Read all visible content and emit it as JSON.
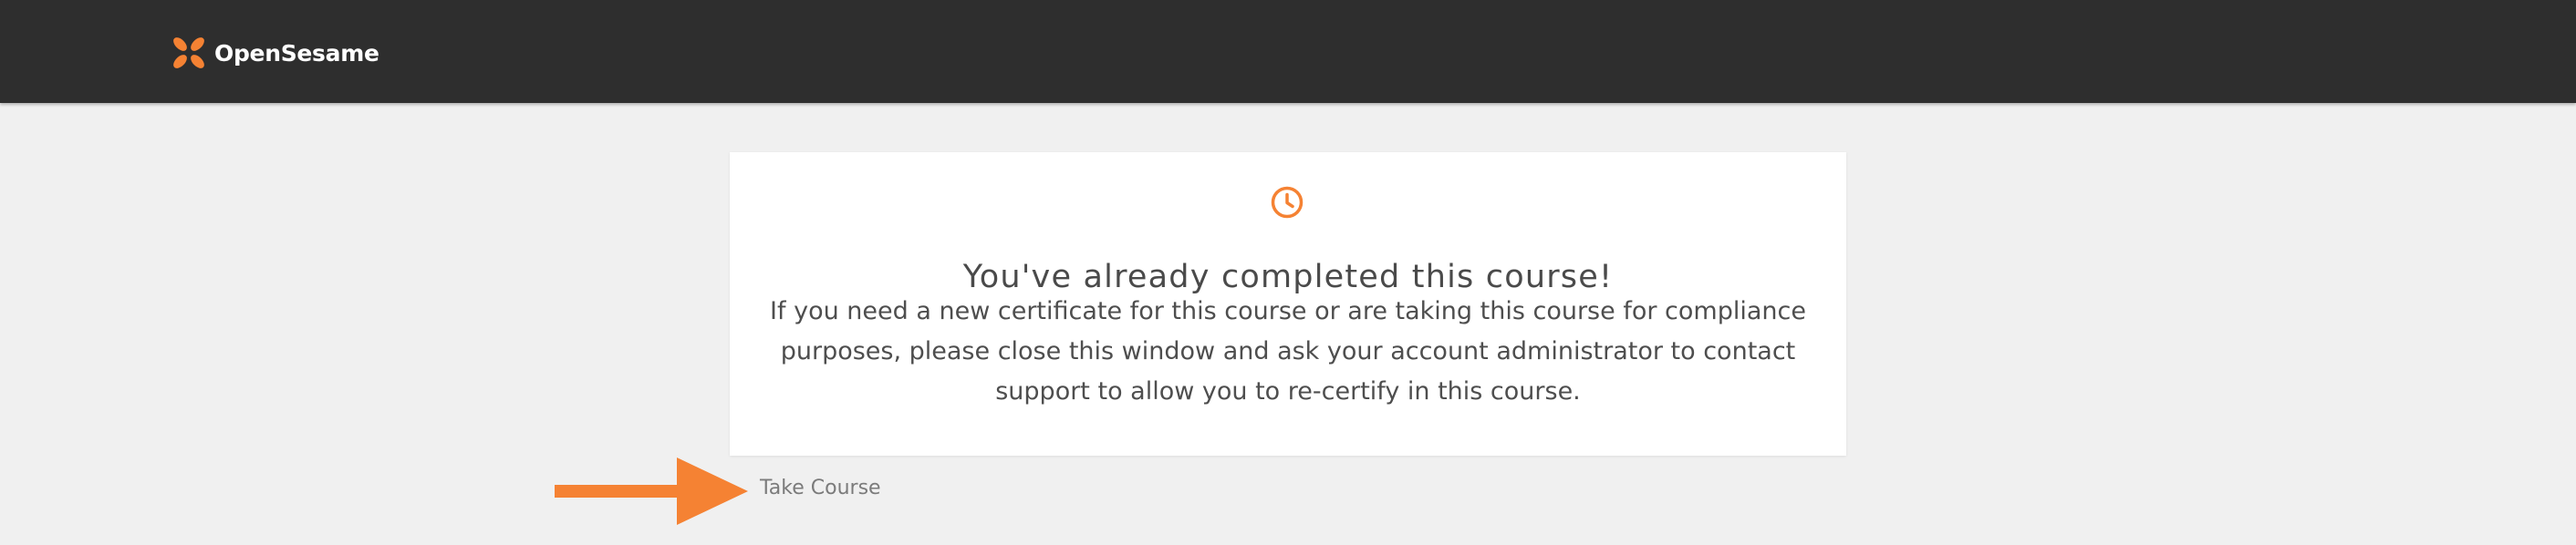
{
  "header": {
    "brand_name": "OpenSesame",
    "logo_icon": "opensesame-logo-icon",
    "colors": {
      "background": "#2e2e2e",
      "accent": "#f58233"
    }
  },
  "notice": {
    "icon": "clock-icon",
    "title": "You've already completed this course!",
    "message": "If you need a new certificate for this course or are taking this course for compliance purposes, please close this window and ask your account administrator to contact support to allow you to re-certify in this course."
  },
  "annotation": {
    "icon": "arrow-right-icon",
    "color": "#f58233"
  },
  "actions": {
    "take_course_label": "Take Course"
  }
}
